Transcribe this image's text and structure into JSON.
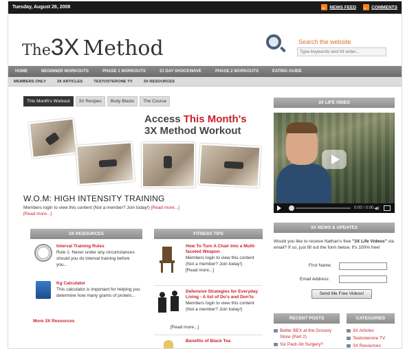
{
  "topbar": {
    "date": "Tuesday, August 26, 2008",
    "news_feed": "NEWS FEED",
    "comments": "COMMENTS"
  },
  "logo": {
    "the": "The",
    "three_x": "3X",
    "method": "Method"
  },
  "search": {
    "title": "Search the website",
    "placeholder": "Type keywords and hit enter..."
  },
  "nav_primary": [
    "HOME",
    "BEGINNER WORKOUTS",
    "PHASE 1 WORKOUTS",
    "21 DAY SHOCKWAVE",
    "PHASE 2 WORKOUTS",
    "EATING GUIDE"
  ],
  "nav_secondary": [
    "MEMBERS ONLY",
    "3X ARTICLES",
    "TESTOSTERONE TV",
    "3X RESOURCES"
  ],
  "tabs": [
    "This Month's Workout",
    "3X Recipes",
    "Body Blasts",
    "The Course"
  ],
  "promo": {
    "line1_prefix": "Access ",
    "line1_highlight": "This Month's",
    "line2": "3X Method Workout"
  },
  "wom": {
    "title": "W.O.M: HIGH INTENSITY TRAINING",
    "text": "Members login to view this content (Not a member? Join today!) ",
    "read_more": "[Read more...]"
  },
  "resources": {
    "header": "3X RESOURCES",
    "items": [
      {
        "title": "Interval Training Rules",
        "text": "Rule 1: Never under any circumstances should you do interval training before you..."
      },
      {
        "title": "Kg Calculator",
        "text": "This calculator is important for helping you determine how many grams of protein..."
      }
    ],
    "more": "More 3X Resources"
  },
  "fitness": {
    "header": "FITNESS TIPS",
    "items": [
      {
        "title": "How To Turn A Chair Into a Multi-faceted Weapon",
        "text": "Members login to view this content (Not a member? Join today!)",
        "read_more": "[Read more...]"
      },
      {
        "title": "Defensive Strategies for Everyday Living - A list of Do's and Don'ts",
        "text": "Members login to view this content (Not a member? Join today!)",
        "read_more": "[Read more...]"
      },
      {
        "title": "Benefits of Black Tea"
      }
    ]
  },
  "video": {
    "header": "3X LIFE VIDEO",
    "time": "0:00 / 0:00",
    "volume": "◀€"
  },
  "news": {
    "header": "3X NEWS & UPDATES",
    "text_before": "Would you like to receive Nathan's free ",
    "text_bold": "\"3X Life Videos\"",
    "text_after": " via email? If so, just fill out the form below. It's 100% free!",
    "first_name": "First Name:",
    "email": "Email Address:",
    "button": "Send Me Free Videos!"
  },
  "recent_posts": {
    "header": "RECENT POSTS",
    "items": [
      "Better BEX at the Grocery Store (Part 2)",
      "Six Pack Ab Surgery?"
    ]
  },
  "categories": {
    "header": "CATEGORIES",
    "items": [
      "3X Articles",
      "Testosterone TV",
      "3X Resources"
    ]
  }
}
